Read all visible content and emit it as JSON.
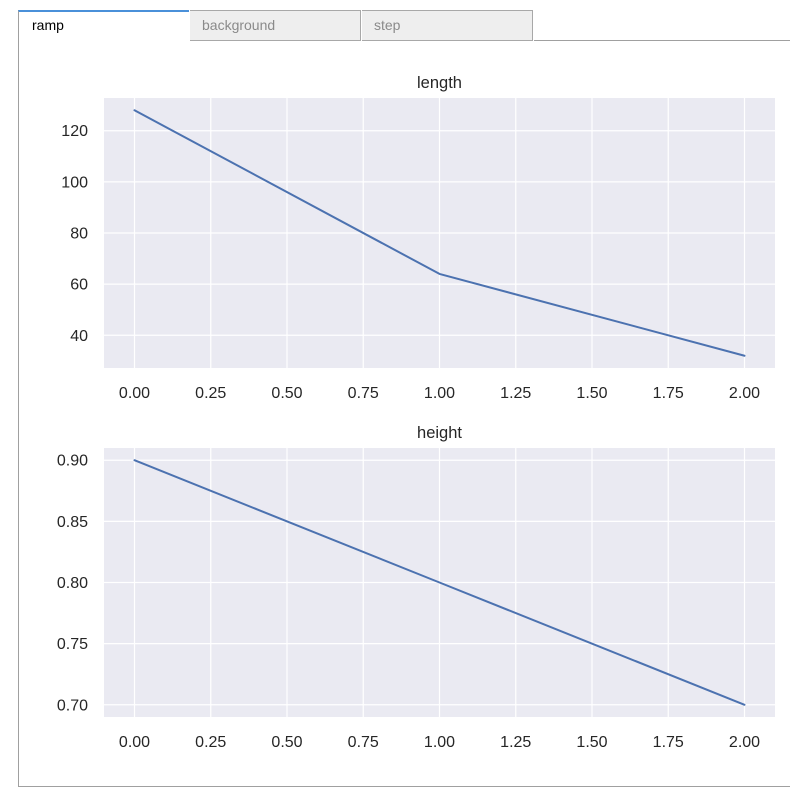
{
  "tabs": [
    {
      "label": "ramp",
      "active": true
    },
    {
      "label": "background",
      "active": false
    },
    {
      "label": "step",
      "active": false
    }
  ],
  "colors": {
    "line": "#4c72b0",
    "plot_background": "#eaeaf2",
    "grid": "#ffffff",
    "active_tab_accent": "#4a90d9"
  },
  "chart_data": [
    {
      "type": "line",
      "title": "length",
      "xlabel": "",
      "ylabel": "",
      "x": [
        0.0,
        1.0,
        2.0
      ],
      "series": [
        {
          "name": "length",
          "values": [
            128,
            64,
            32
          ]
        }
      ],
      "xlim": [
        -0.1,
        2.1
      ],
      "ylim": [
        27.2,
        132.8
      ],
      "xticks": [
        0.0,
        0.25,
        0.5,
        0.75,
        1.0,
        1.25,
        1.5,
        1.75,
        2.0
      ],
      "xtick_labels": [
        "0.00",
        "0.25",
        "0.50",
        "0.75",
        "1.00",
        "1.25",
        "1.50",
        "1.75",
        "2.00"
      ],
      "yticks": [
        40,
        60,
        80,
        100,
        120
      ],
      "ytick_labels": [
        "40",
        "60",
        "80",
        "100",
        "120"
      ],
      "grid": true,
      "legend": "none"
    },
    {
      "type": "line",
      "title": "height",
      "xlabel": "",
      "ylabel": "",
      "x": [
        0.0,
        1.0,
        2.0
      ],
      "series": [
        {
          "name": "height",
          "values": [
            0.9,
            0.8,
            0.7
          ]
        }
      ],
      "xlim": [
        -0.1,
        2.1
      ],
      "ylim": [
        0.69,
        0.91
      ],
      "xticks": [
        0.0,
        0.25,
        0.5,
        0.75,
        1.0,
        1.25,
        1.5,
        1.75,
        2.0
      ],
      "xtick_labels": [
        "0.00",
        "0.25",
        "0.50",
        "0.75",
        "1.00",
        "1.25",
        "1.50",
        "1.75",
        "2.00"
      ],
      "yticks": [
        0.7,
        0.75,
        0.8,
        0.85,
        0.9
      ],
      "ytick_labels": [
        "0.70",
        "0.75",
        "0.80",
        "0.85",
        "0.90"
      ],
      "grid": true,
      "legend": "none"
    }
  ]
}
